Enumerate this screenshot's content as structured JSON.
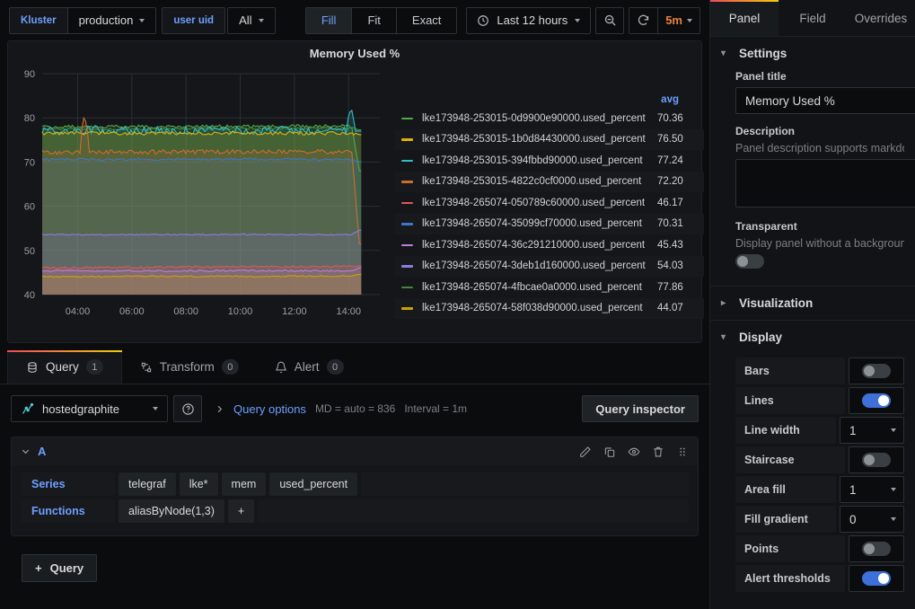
{
  "toolbar": {
    "variables": [
      {
        "label": "Kluster",
        "value": "production",
        "has_caret": true
      },
      {
        "label": "user uid",
        "value": "All",
        "has_caret": true
      }
    ],
    "segments": [
      {
        "label": "Fill",
        "active": true
      },
      {
        "label": "Fit",
        "active": false
      },
      {
        "label": "Exact",
        "active": false
      }
    ],
    "time_range": "Last 12 hours",
    "zoom_out_icon": "zoom-out-icon",
    "refresh_icon": "refresh-icon",
    "refresh_interval": "5m"
  },
  "panel": {
    "title": "Memory Used %",
    "legend_header": "avg"
  },
  "chart_data": {
    "type": "line",
    "title": "Memory Used %",
    "xlabel": "",
    "ylabel": "",
    "ylim": [
      40,
      90
    ],
    "yticks": [
      40,
      50,
      60,
      70,
      80,
      90
    ],
    "xticks": [
      "04:00",
      "06:00",
      "08:00",
      "10:00",
      "12:00",
      "14:00"
    ],
    "grid": true,
    "legend_position": "right",
    "area_fill": true,
    "series": [
      {
        "name": "lke173948-253015-0d9900e90000.used_percent",
        "avg": "70.36",
        "color": "#56a64b",
        "level": 78.0,
        "noise": 0.35,
        "spike_x": null,
        "drop_to": 68.0
      },
      {
        "name": "lke173948-253015-1b0d84430000.used_percent",
        "avg": "76.50",
        "color": "#e0b400",
        "level": 76.5,
        "noise": 0.4,
        "spike_x": null,
        "drop_to": 76.2
      },
      {
        "name": "lke173948-253015-394fbbd90000.used_percent",
        "avg": "77.24",
        "color": "#37bbca",
        "level": 77.2,
        "noise": 0.9,
        "spike_x": 0.915,
        "spike_to": 82.2,
        "drop_to": 77.0
      },
      {
        "name": "lke173948-253015-4822c0cf0000.used_percent",
        "avg": "72.20",
        "color": "#cc6d33",
        "level": 72.2,
        "noise": 0.5,
        "spike_x": 0.125,
        "spike_to": 80.8,
        "drop_to": 51.5
      },
      {
        "name": "lke173948-265074-050789c60000.used_percent",
        "avg": "46.17",
        "color": "#e0565b",
        "level": 46.1,
        "noise": 0.2,
        "spike_x": null,
        "drop_to": 46.5
      },
      {
        "name": "lke173948-265074-35099cf70000.used_percent",
        "avg": "70.31",
        "color": "#3b78c8",
        "level": 70.6,
        "noise": 0.25,
        "spike_x": null,
        "drop_to": 70.1
      },
      {
        "name": "lke173948-265074-36c291210000.used_percent",
        "avg": "45.43",
        "color": "#c47cd4",
        "level": 45.4,
        "noise": 0.18,
        "spike_x": null,
        "drop_to": 46.1
      },
      {
        "name": "lke173948-265074-3deb1d160000.used_percent",
        "avg": "54.03",
        "color": "#8f7ae0",
        "level": 53.6,
        "noise": 0.15,
        "spike_x": null,
        "drop_to": 54.6
      },
      {
        "name": "lke173948-265074-4fbcae0a0000.used_percent",
        "avg": "77.86",
        "color": "#438a3b",
        "level": 77.5,
        "noise": 0.25,
        "spike_x": null,
        "drop_to": 77.3
      },
      {
        "name": "lke173948-265074-58f038d90000.used_percent",
        "avg": "44.07",
        "color": "#c9a500",
        "level": 44.0,
        "noise": 0.15,
        "spike_x": null,
        "drop_to": 44.6
      }
    ]
  },
  "edit_tabs": [
    {
      "label": "Query",
      "count": "1",
      "icon": "database-icon",
      "active": true
    },
    {
      "label": "Transform",
      "count": "0",
      "icon": "transform-icon",
      "active": false
    },
    {
      "label": "Alert",
      "count": "0",
      "icon": "bell-icon",
      "active": false
    }
  ],
  "query_editor": {
    "datasource": "hostedgraphite",
    "datasource_icon": "graphite-icon",
    "help_icon": "help-circle-icon",
    "query_options_label": "Query options",
    "query_options_meta_md": "MD = auto = 836",
    "query_options_meta_interval": "Interval = 1m",
    "query_inspector_label": "Query inspector",
    "add_query_label": "Query",
    "query": {
      "ref_id": "A",
      "actions": [
        "pencil-icon",
        "copy-icon",
        "eye-icon",
        "trash-icon",
        "drag-handle-icon"
      ],
      "rows": [
        {
          "label": "Series",
          "tags": [
            "telegraf",
            "lke*",
            "mem",
            "used_percent"
          ],
          "add": false
        },
        {
          "label": "Functions",
          "tags": [
            "aliasByNode(1,3)"
          ],
          "add": true
        }
      ]
    }
  },
  "options_pane": {
    "tabs": [
      {
        "label": "Panel",
        "active": true
      },
      {
        "label": "Field",
        "active": false
      },
      {
        "label": "Overrides",
        "active": false
      }
    ],
    "settings": {
      "header": "Settings",
      "panel_title_label": "Panel title",
      "panel_title_value": "Memory Used %",
      "description_label": "Description",
      "description_help": "Panel description supports markdown and links.",
      "description_value": "",
      "transparent_label": "Transparent",
      "transparent_help": "Display panel without a background.",
      "transparent_on": false
    },
    "visualization_header": "Visualization",
    "display": {
      "header": "Display",
      "options": [
        {
          "label": "Bars",
          "type": "toggle",
          "value": "off"
        },
        {
          "label": "Lines",
          "type": "toggle",
          "value": "on"
        },
        {
          "label": "Line width",
          "type": "select",
          "value": "1"
        },
        {
          "label": "Staircase",
          "type": "toggle",
          "value": "off"
        },
        {
          "label": "Area fill",
          "type": "select",
          "value": "1"
        },
        {
          "label": "Fill gradient",
          "type": "select",
          "value": "0"
        },
        {
          "label": "Points",
          "type": "toggle",
          "value": "off"
        },
        {
          "label": "Alert thresholds",
          "type": "toggle",
          "value": "on"
        }
      ]
    }
  }
}
